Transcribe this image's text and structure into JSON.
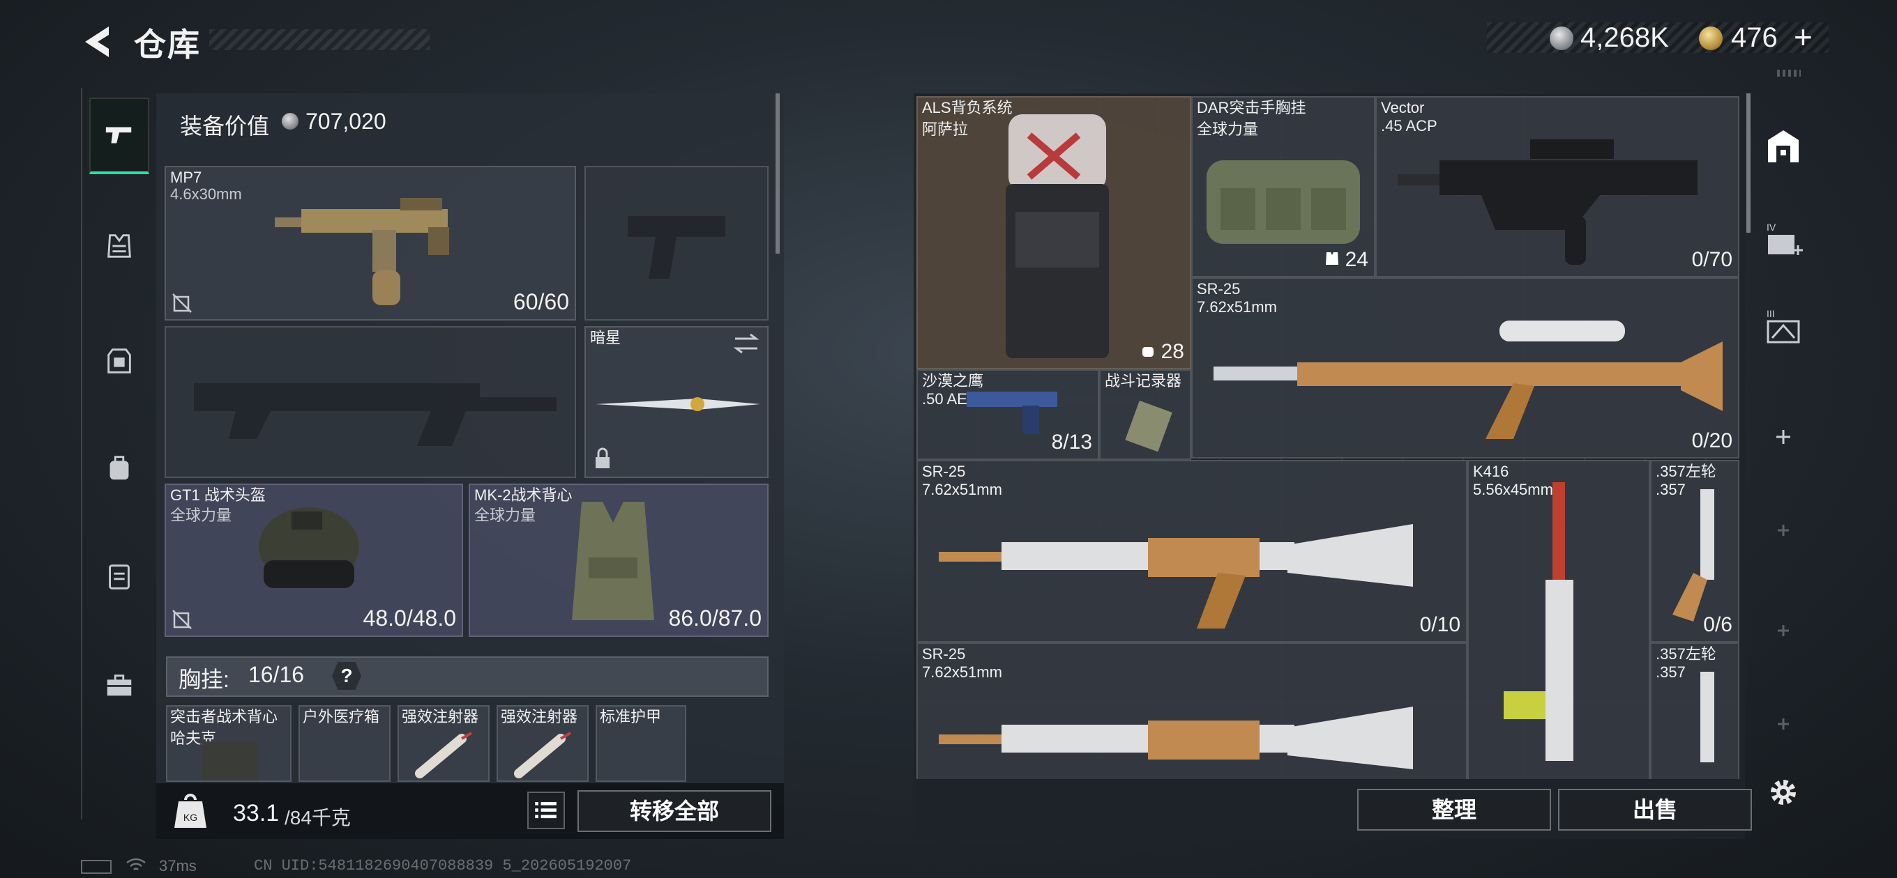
{
  "header": {
    "title": "仓库",
    "currency_silver": "4,268K",
    "currency_gold": "476",
    "currency_gold_plus": "+"
  },
  "left_panel": {
    "equip_value_label": "装备价值",
    "equip_value": "707,020",
    "slots": {
      "primary": {
        "name": "MP7",
        "sub": "4.6x30mm",
        "count": "60/60"
      },
      "knife": {
        "name": "暗星"
      },
      "helmet": {
        "name": "GT1 战术头盔",
        "sub": "全球力量",
        "count": "48.0/48.0"
      },
      "vest": {
        "name": "MK-2战术背心",
        "sub": "全球力量",
        "count": "86.0/87.0"
      }
    },
    "chest_label": "胸挂:",
    "chest_count": "16/16",
    "chest_help": "?",
    "chest_items": [
      {
        "name": "突击者战术背心",
        "sub": "哈夫克"
      },
      {
        "name": "户外医疗箱"
      },
      {
        "name": "强效注射器"
      },
      {
        "name": "强效注射器"
      },
      {
        "name": "标准护甲"
      }
    ],
    "weight_value": "33.1",
    "weight_max": "/84千克",
    "transfer_label": "转移全部"
  },
  "storage": {
    "items": [
      {
        "name": "ALS背负系统",
        "sub": "阿萨拉",
        "count": "28"
      },
      {
        "name": "DAR突击手胸挂",
        "sub": "全球力量",
        "count": "24"
      },
      {
        "name": "Vector",
        "sub": ".45 ACP",
        "count": "0/70"
      },
      {
        "name": "SR-25",
        "sub": "7.62x51mm",
        "count": "0/20"
      },
      {
        "name": "沙漠之鹰",
        "sub": ".50 AE",
        "count": "8/13"
      },
      {
        "name": "战斗记录器"
      },
      {
        "name": "SR-25",
        "sub": "7.62x51mm",
        "count": "0/10"
      },
      {
        "name": "K416",
        "sub": "5.56x45mm"
      },
      {
        "name": ".357左轮",
        "sub": ".357",
        "count": "0/6"
      },
      {
        "name": "SR-25",
        "sub": "7.62x51mm"
      },
      {
        "name": ".357左轮",
        "sub": ".357"
      }
    ],
    "organize_label": "整理",
    "sell_label": "出售"
  },
  "right_nav": {
    "tab2_badge": "IV",
    "tab3_badge": "III"
  },
  "status": {
    "ping": "37ms",
    "uid": "CN UID:5481182690407088839 5_202605192007"
  },
  "colors": {
    "accent_green": "#2fe0a0",
    "panel_bg": "#282e36",
    "brown_tile": "#52463c"
  }
}
